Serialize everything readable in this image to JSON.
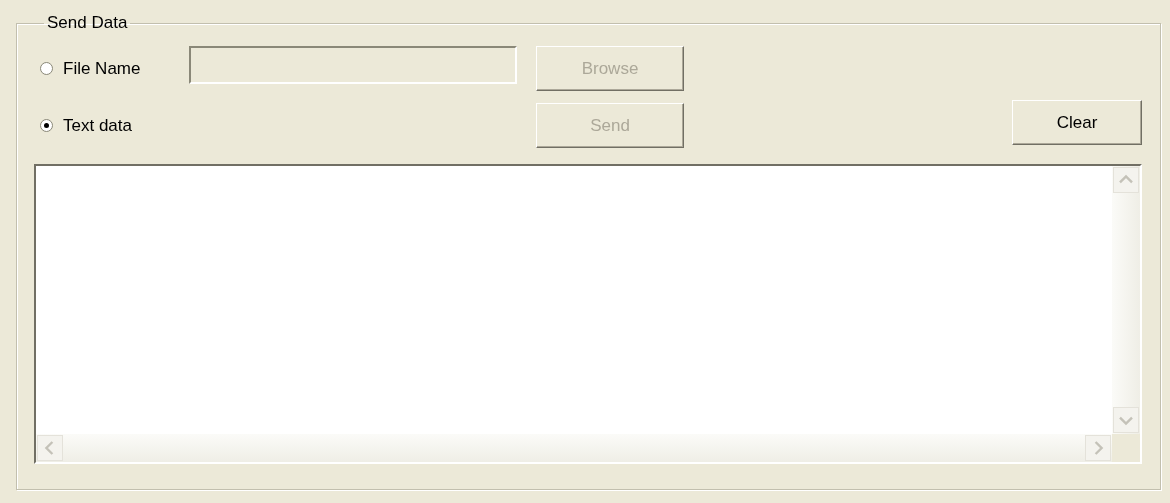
{
  "group": {
    "title": "Send Data"
  },
  "sources": [
    {
      "label": "File Name",
      "selected": false
    },
    {
      "label": "Text data",
      "selected": true
    }
  ],
  "file_name": {
    "disabled": true
  },
  "buttons": [
    {
      "label": "Browse",
      "disabled": true
    },
    {
      "label": "Send",
      "disabled": true
    },
    {
      "label": "Clear",
      "disabled": false
    }
  ]
}
